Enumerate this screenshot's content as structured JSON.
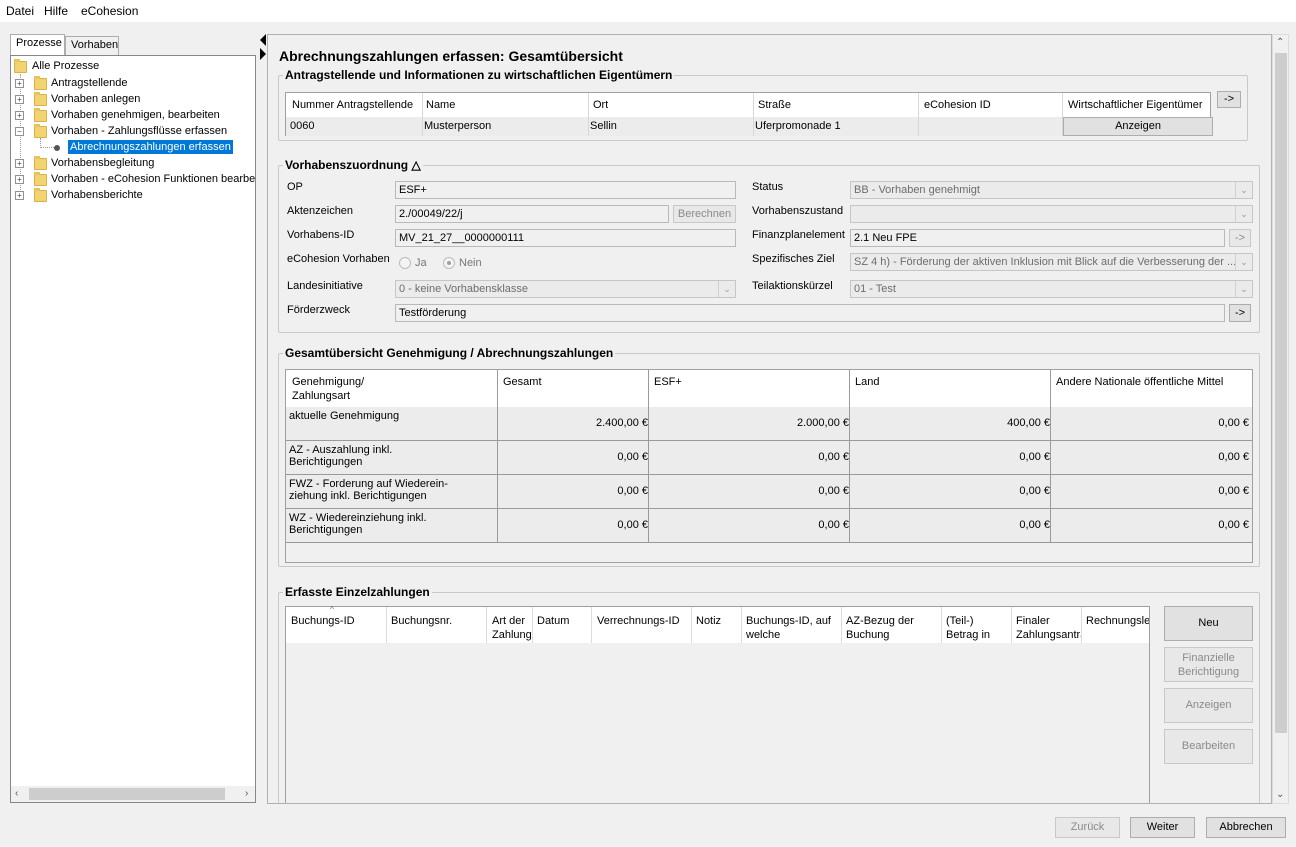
{
  "menu": {
    "datei": "Datei",
    "hilfe": "Hilfe",
    "ecohesion": "eCohesion"
  },
  "left_tabs": {
    "prozesse": "Prozesse",
    "vorhaben": "Vorhaben"
  },
  "tree": {
    "root": "Alle Prozesse",
    "items": [
      "Antragstellende",
      "Vorhaben anlegen",
      "Vorhaben genehmigen, bearbeiten",
      "Vorhaben - Zahlungsflüsse erfassen",
      "Vorhabensbegleitung",
      "Vorhaben - eCohesion Funktionen bearbeiten",
      "Vorhabensberichte"
    ],
    "selected": "Abrechnungszahlungen erfassen"
  },
  "page_title": "Abrechnungszahlungen erfassen: Gesamtübersicht",
  "antrag": {
    "legend": "Antragstellende und Informationen zu wirtschaftlichen Eigentümern",
    "headers": [
      "Nummer Antragstellende",
      "Name",
      "Ort",
      "Straße",
      "eCohesion ID",
      "Wirtschaftlicher Eigentümer"
    ],
    "row": [
      "0060",
      "Musterperson",
      "Sellin",
      "Uferpromonade 1",
      "",
      "Anzeigen"
    ],
    "arrow": "->"
  },
  "vorhaben": {
    "legend": "Vorhabenszuordnung △",
    "op_label": "OP",
    "op_value": "ESF+",
    "akten_label": "Aktenzeichen",
    "akten_value": "2./00049/22/j",
    "berechnen": "Berechnen",
    "vid_label": "Vorhabens-ID",
    "vid_value": "MV_21_27__0000000111",
    "ecv_label": "eCohesion Vorhaben",
    "ja": "Ja",
    "nein": "Nein",
    "landes_label": "Landesinitiative",
    "landes_value": "0 - keine Vorhabensklasse",
    "zweck_label": "Förderzweck",
    "zweck_value": "Testförderung",
    "status_label": "Status",
    "status_value": "BB - Vorhaben genehmigt",
    "zustand_label": "Vorhabenszustand",
    "zustand_value": "",
    "fpe_label": "Finanzplanelement",
    "fpe_value": "2.1 Neu FPE",
    "ziel_label": "Spezifisches Ziel",
    "ziel_value": "SZ 4 h) - Förderung der aktiven Inklusion mit Blick auf die Verbesserung der ...",
    "teil_label": "Teilaktionskürzel",
    "teil_value": "01 - Test",
    "arrow": "->"
  },
  "gesamt": {
    "legend": "Gesamtübersicht Genehmigung / Abrechnungszahlungen",
    "headers": [
      "Genehmigung/\nZahlungsart",
      "Gesamt",
      "ESF+",
      "Land",
      "Andere Nationale öffentliche Mittel"
    ],
    "rows": [
      {
        "label": "aktuelle Genehmigung",
        "values": [
          "2.400,00 €",
          "2.000,00 €",
          "400,00 €",
          "0,00 €"
        ]
      },
      {
        "label": "AZ - Auszahlung inkl.\nBerichtigungen",
        "values": [
          "0,00 €",
          "0,00 €",
          "0,00 €",
          "0,00 €"
        ]
      },
      {
        "label": "FWZ - Forderung auf Wiederein-\nziehung inkl. Berichtigungen",
        "values": [
          "0,00 €",
          "0,00 €",
          "0,00 €",
          "0,00 €"
        ]
      },
      {
        "label": "WZ - Wiedereinziehung inkl.\nBerichtigungen",
        "values": [
          "0,00 €",
          "0,00 €",
          "0,00 €",
          "0,00 €"
        ]
      }
    ]
  },
  "einzel": {
    "legend": "Erfasste Einzelzahlungen",
    "headers": [
      "Buchungs-ID",
      "Buchungsnr.",
      "Art der\nZahlung",
      "Datum",
      "Verrechnungs-ID",
      "Notiz",
      "Buchungs-ID, auf\nwelche\ndie Buch...",
      "AZ-Bezug der\nBuchung",
      "(Teil-)\nBetrag in\nEUR",
      "Finaler\nZahlungsantrag",
      "Rechnungslegung"
    ],
    "buttons": {
      "neu": "Neu",
      "fin": "Finanzielle\nBerichtigung",
      "anzeigen": "Anzeigen",
      "bearbeiten": "Bearbeiten"
    }
  },
  "footer": {
    "zurueck": "Zurück",
    "weiter": "Weiter",
    "abbrechen": "Abbrechen"
  }
}
